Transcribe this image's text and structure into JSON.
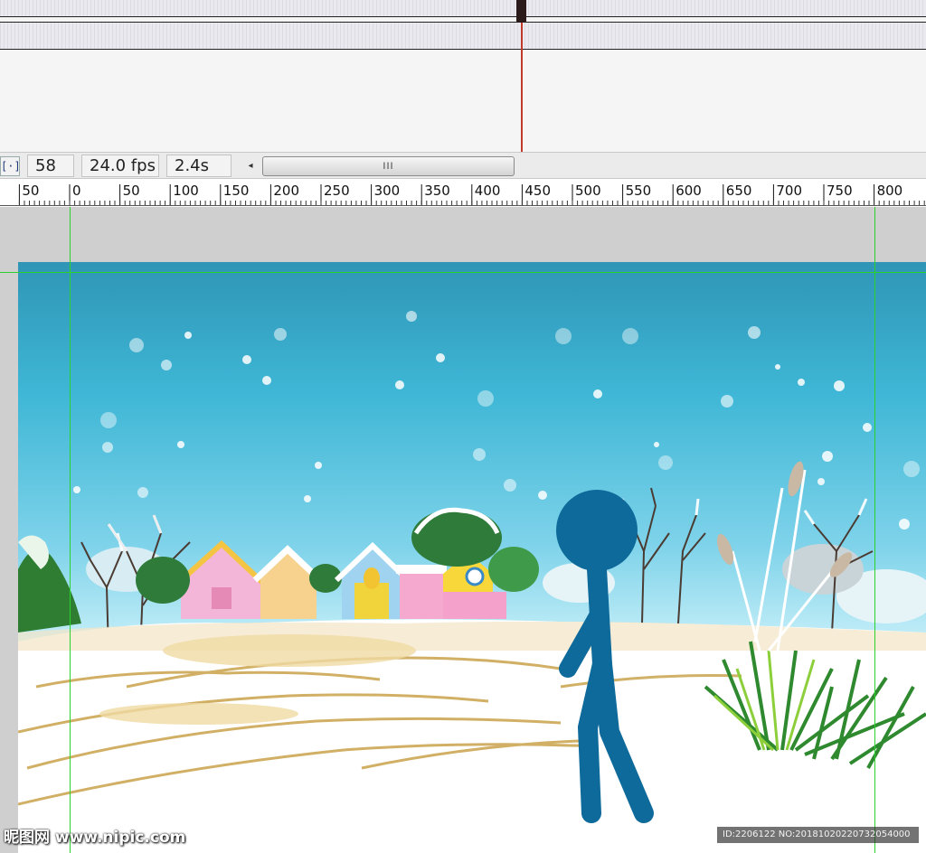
{
  "status_bar": {
    "center_frame_icon": "center-frame-icon",
    "current_frame": "58",
    "frame_rate": "24.0 fps",
    "elapsed_time": "2.4s",
    "scroll_arrow_left": "◂",
    "scroll_thumb_grip": "III"
  },
  "ruler": {
    "labels": [
      "50",
      "0",
      "50",
      "100",
      "150",
      "200",
      "250",
      "300",
      "350",
      "400",
      "450",
      "500",
      "550",
      "600",
      "650",
      "700",
      "750",
      "800"
    ]
  },
  "watermark": {
    "left": "昵图网 www.nipic.com",
    "right": "ID:2206122 NO:20181020220732054000"
  },
  "colors": {
    "sky_top": "#2f95b6",
    "sky_bottom": "#a9e5f3",
    "stick_figure": "#0e6a9a",
    "guide": "#2bd22b",
    "playhead": "#c0392b"
  }
}
